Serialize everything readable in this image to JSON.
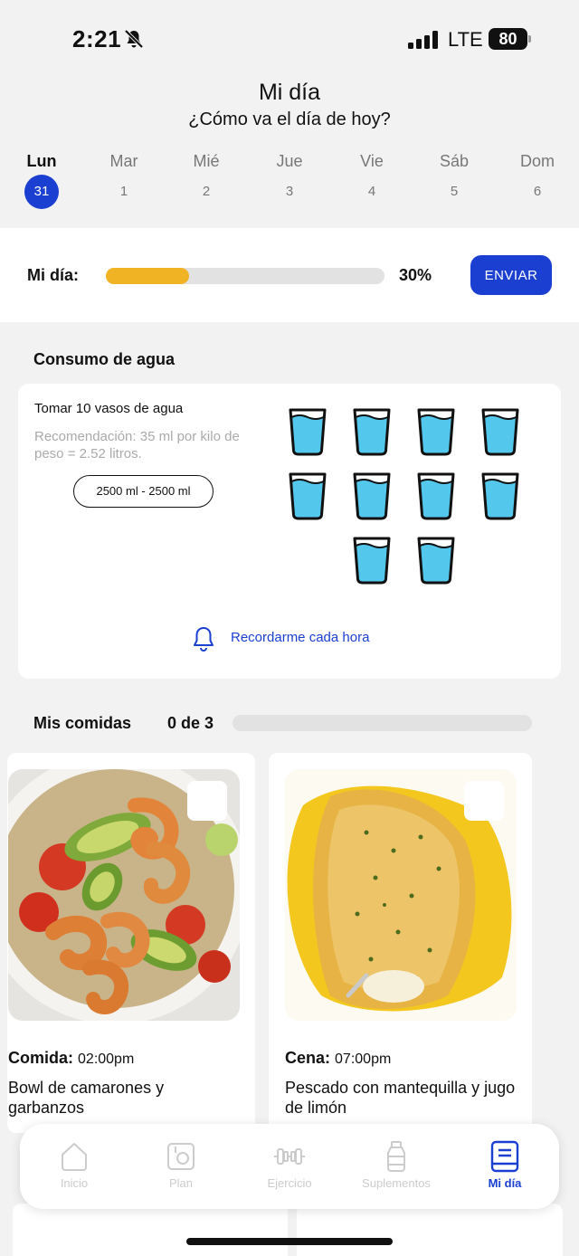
{
  "status": {
    "time": "2:21",
    "network": "LTE",
    "battery": "80"
  },
  "header": {
    "title": "Mi día",
    "subtitle": "¿Cómo va el día de hoy?"
  },
  "days": [
    {
      "name": "Lun",
      "num": "31",
      "active": true
    },
    {
      "name": "Mar",
      "num": "1"
    },
    {
      "name": "Mié",
      "num": "2"
    },
    {
      "name": "Jue",
      "num": "3"
    },
    {
      "name": "Vie",
      "num": "4"
    },
    {
      "name": "Sáb",
      "num": "5"
    },
    {
      "name": "Dom",
      "num": "6"
    }
  ],
  "progress": {
    "label": "Mi día:",
    "percent_text": "30%",
    "value": 0.3,
    "send_label": "ENVIAR",
    "bar_color": "#f0b323"
  },
  "water": {
    "section_title": "Consumo de agua",
    "goal": "Tomar 10 vasos de agua",
    "recommendation": "Recomendación: 35 ml por kilo de peso = 2.52 litros.",
    "range": "2500 ml - 2500 ml",
    "glasses_total": 10,
    "reminder_label": "Recordarme cada hora",
    "water_color": "#53c8ec"
  },
  "meals": {
    "section_title": "Mis comidas",
    "counter": "0 de 3",
    "items": [
      {
        "type": "Comida:",
        "time": "02:00pm",
        "name": "Bowl de camarones y garbanzos"
      },
      {
        "type": "Cena:",
        "time": "07:00pm",
        "name": "Pescado con mantequilla y jugo de limón"
      }
    ]
  },
  "tabs": [
    {
      "label": "Inicio",
      "icon": "home-icon"
    },
    {
      "label": "Plan",
      "icon": "plan-icon"
    },
    {
      "label": "Ejercicio",
      "icon": "dumbbell-icon"
    },
    {
      "label": "Suplementos",
      "icon": "supplement-bottle-icon"
    },
    {
      "label": "Mi día",
      "icon": "journal-icon",
      "active": true
    }
  ],
  "colors": {
    "accent": "#1a3fd1",
    "progress": "#f0b323"
  }
}
